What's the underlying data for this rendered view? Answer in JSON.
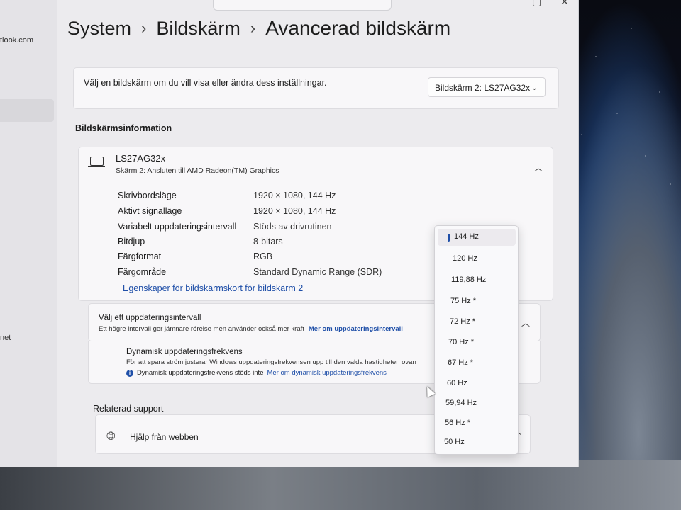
{
  "account": {
    "email_partial": "tlook.com"
  },
  "nav": {
    "partial_label": "net"
  },
  "breadcrumb": {
    "level1": "System",
    "level2": "Bildskärm",
    "level3": "Avancerad bildskärm",
    "separator": "›"
  },
  "display_select": {
    "prompt": "Välj en bildskärm om du vill visa eller ändra dess inställningar.",
    "selected": "Bildskärm 2: LS27AG32x"
  },
  "display_info": {
    "section_title": "Bildskärmsinformation",
    "name": "LS27AG32x",
    "subtitle": "Skärm 2: Ansluten till AMD Radeon(TM) Graphics",
    "rows": [
      {
        "label": "Skrivbordsläge",
        "value": "1920 × 1080, 144 Hz"
      },
      {
        "label": "Aktivt signalläge",
        "value": "1920 × 1080, 144 Hz"
      },
      {
        "label": "Variabelt uppdateringsintervall",
        "value": "Stöds av drivrutinen"
      },
      {
        "label": "Bitdjup",
        "value": "8-bitars"
      },
      {
        "label": "Färgformat",
        "value": "RGB"
      },
      {
        "label": "Färgområde",
        "value": "Standard Dynamic Range (SDR)"
      }
    ],
    "adapter_link": "Egenskaper för bildskärmskort för bildskärm 2"
  },
  "refresh": {
    "title": "Välj ett uppdateringsintervall",
    "subtitle": "Ett högre intervall ger jämnare rörelse men använder också mer kraft",
    "link": "Mer om uppdateringsintervall"
  },
  "dynamic": {
    "title": "Dynamisk uppdateringsfrekvens",
    "description": "För att spara ström justerar Windows uppdateringsfrekvensen upp till den valda hastigheten ovan",
    "info": "Dynamisk uppdateringsfrekvens stöds inte",
    "link": "Mer om dynamisk uppdateringsfrekvens"
  },
  "related": {
    "title": "Relaterad support",
    "help_label": "Hjälp från webben"
  },
  "refresh_options": {
    "selected": "144 Hz",
    "items": [
      "144 Hz",
      "120 Hz",
      "119,88 Hz",
      "75 Hz *",
      "72 Hz *",
      "70 Hz *",
      "67 Hz *",
      "60 Hz",
      "59,94 Hz",
      "56 Hz *",
      "50 Hz"
    ]
  },
  "icons": {
    "monitor": "monitor-icon",
    "globe": "globe-icon",
    "info": "info-icon",
    "chevron_up": "chevron-up-icon",
    "chevron_down": "chevron-down-icon"
  },
  "colors": {
    "accent": "#1f4fa8",
    "window_bg": "#ecebee",
    "card_bg": "#f8f7f9"
  }
}
